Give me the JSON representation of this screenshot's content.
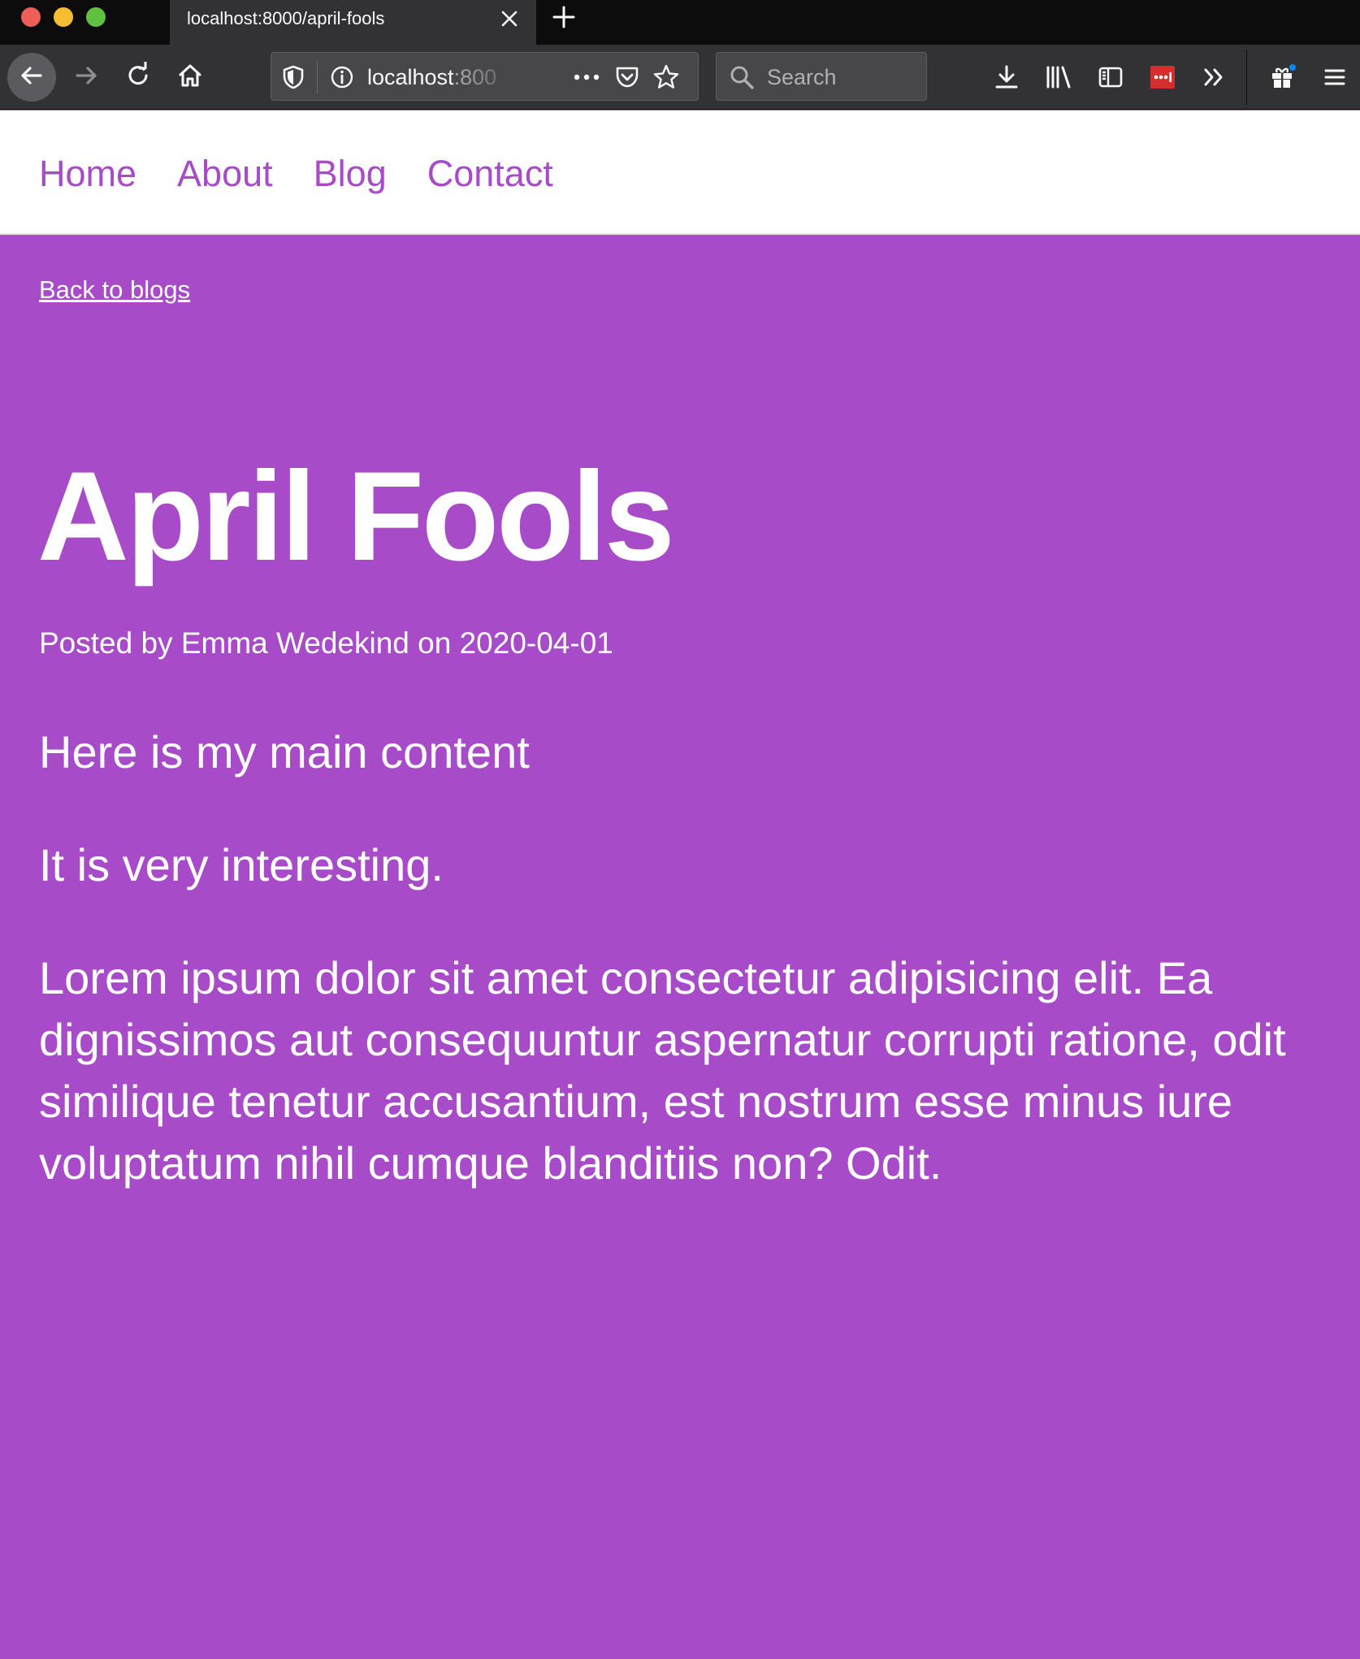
{
  "browser": {
    "tab_title": "localhost:8000/april-fools",
    "url_host": "localhost",
    "url_port": ":800",
    "search_placeholder": "Search",
    "icons": [
      "close-icon",
      "plus-icon",
      "arrow-left-icon",
      "arrow-right-icon",
      "reload-icon",
      "home-icon",
      "shield-icon",
      "info-icon",
      "more-icon",
      "pocket-icon",
      "star-icon",
      "search-icon",
      "download-icon",
      "library-icon",
      "sidebar-icon",
      "lastpass-icon",
      "chevron-double-right-icon",
      "gift-icon",
      "hamburger-icon"
    ]
  },
  "nav": {
    "items": [
      {
        "label": "Home"
      },
      {
        "label": "About"
      },
      {
        "label": "Blog"
      },
      {
        "label": "Contact"
      }
    ]
  },
  "post": {
    "back_label": "Back to blogs",
    "title": "April Fools",
    "meta": "Posted by Emma Wedekind on 2020-04-01",
    "paragraphs": [
      "Here is my main content",
      "It is very interesting.",
      "Lorem ipsum dolor sit amet consectetur adipisicing elit. Ea dignissimos aut consequuntur aspernatur corrupti ratione, odit similique tenetur accusantium, est nostrum esse minus iure voluptatum nihil cumque blanditiis non? Odit."
    ]
  },
  "colors": {
    "accent": "#a84bc8",
    "nav_bg": "#ffffff",
    "chrome_dark": "#0c0c0d",
    "chrome_toolbar": "#323234",
    "extension_red": "#d32f2f"
  }
}
